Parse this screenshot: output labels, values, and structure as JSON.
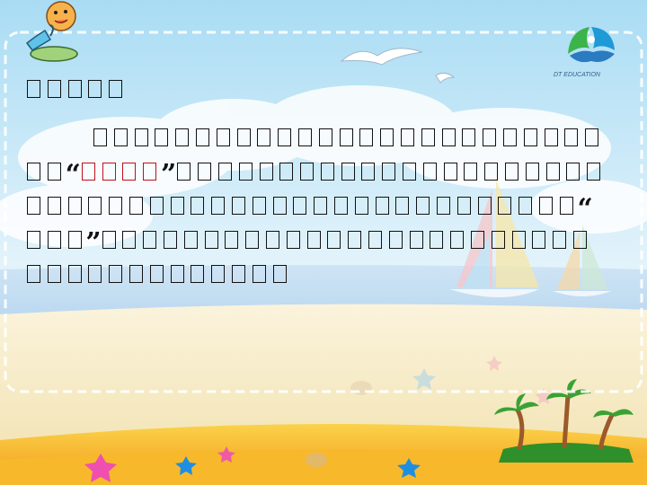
{
  "logo": {
    "name_cn": "",
    "caption": "DT EDUCATION",
    "icon": "dt-education-logo-icon"
  },
  "mascot": {
    "icon": "cartoon-microphone-icon"
  },
  "text": {
    "heading_glyphs": 5,
    "paragraph_glyph_rows": [
      [
        2,
        "open_quote",
        {
          "red": 4
        },
        "close_quote",
        21
      ],
      [
        27,
        "open_quote"
      ],
      [
        3,
        "close_quote",
        24
      ],
      [
        13
      ]
    ],
    "first_row_glyphs": 25,
    "quote_open": "“",
    "quote_close": "”"
  },
  "colors": {
    "highlight": "#c0101a",
    "text": "#111111",
    "sky": "#bfe3f6",
    "sand": "#f7ecc8",
    "frame": "#f2a71d"
  }
}
